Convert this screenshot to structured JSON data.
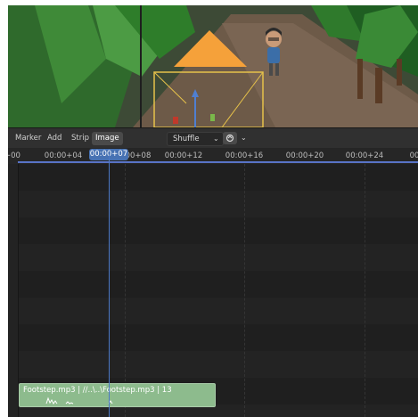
{
  "header": {
    "menu": [
      {
        "label": "Marker"
      },
      {
        "label": "Add"
      },
      {
        "label": "Strip"
      },
      {
        "label": "Image"
      }
    ],
    "pivot_dropdown": {
      "value": "Shuffle"
    }
  },
  "ruler": {
    "ticks": [
      "+00",
      "00:00+04",
      "00+08",
      "00:00+12",
      "00:00+16",
      "00:00+20",
      "00:00+24",
      "00"
    ],
    "current_time": "00:00+07"
  },
  "strip": {
    "label": "Footstep.mp3 | //..\\..\\Footstep.mp3 | 13",
    "color": "#8dbb8d"
  },
  "colors": {
    "accent": "#4772b3",
    "gizmo": "#f5a13a",
    "selection_box": "#e6c24a"
  }
}
